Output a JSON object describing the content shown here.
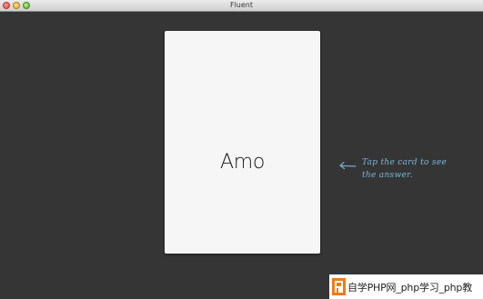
{
  "window": {
    "title": "Fluent"
  },
  "card": {
    "word": "Amo"
  },
  "hint": {
    "line1": "Tap the card to see",
    "line2": "the answer."
  },
  "watermark": {
    "text": "自学PHP网_php学习_php教"
  },
  "colors": {
    "background": "#353535",
    "card": "#f6f6f6",
    "hint": "#7ab6d8",
    "watermark_accent": "#f07b16"
  },
  "icons": {
    "hint_arrow": "left-arrow-icon",
    "watermark_logo": "php-logo-icon"
  }
}
